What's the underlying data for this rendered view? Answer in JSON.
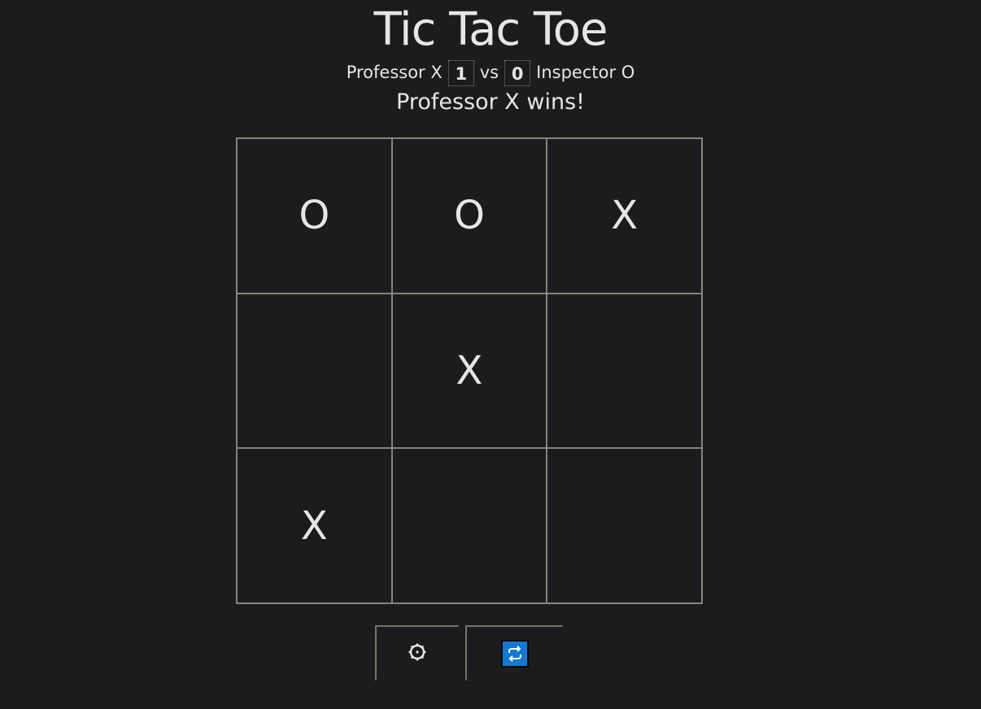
{
  "title": "Tic Tac Toe",
  "scoreboard": {
    "player_x": "Professor X",
    "score_x": "1",
    "vs": "vs",
    "score_o": "0",
    "player_o": "Inspector O"
  },
  "status": "Professor X wins!",
  "board": [
    "O",
    "O",
    "X",
    "",
    "X",
    "",
    "X",
    "",
    ""
  ],
  "controls": {
    "settings_icon": "gear-icon",
    "restart_icon": "refresh-icon",
    "restart_color": "#1478d4"
  }
}
